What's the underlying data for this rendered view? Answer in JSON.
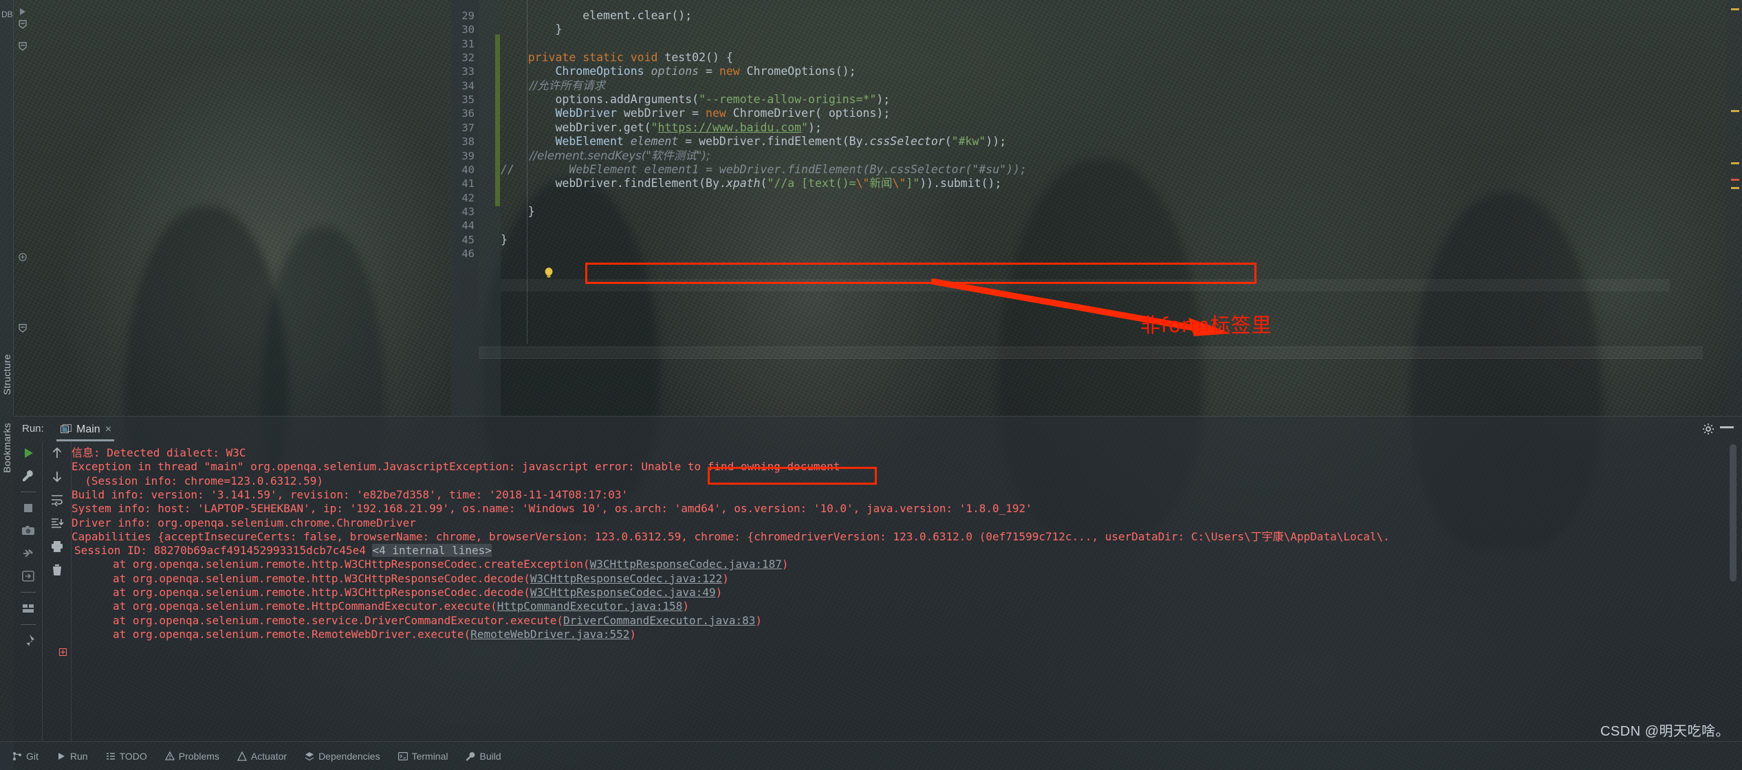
{
  "window": {
    "left_rail_top_label": "DB",
    "left_rail_structure": "Structure",
    "left_rail_bookmarks": "Bookmarks"
  },
  "editor": {
    "line_numbers": [
      "29",
      "30",
      "31",
      "32",
      "33",
      "34",
      "35",
      "36",
      "37",
      "38",
      "39",
      "40",
      "41",
      "42",
      "43",
      "44",
      "45",
      "46"
    ],
    "lines": [
      {
        "num": "29",
        "segments": [
          {
            "t": "            element",
            "c": "plain"
          },
          {
            "t": ".clear",
            "c": "plain"
          },
          {
            "t": "();",
            "c": "plain"
          }
        ]
      },
      {
        "num": "30",
        "segments": [
          {
            "t": "        }",
            "c": "plain"
          }
        ]
      },
      {
        "num": "31",
        "segments": [
          {
            "t": "",
            "c": "plain"
          }
        ]
      },
      {
        "num": "32",
        "segments": [
          {
            "t": "    private static void ",
            "c": "kw"
          },
          {
            "t": "test02",
            "c": "plain"
          },
          {
            "t": "() {",
            "c": "plain"
          }
        ]
      },
      {
        "num": "33",
        "segments": [
          {
            "t": "        ChromeOptions ",
            "c": "type"
          },
          {
            "t": "options",
            "c": "var"
          },
          {
            "t": " = ",
            "c": "plain"
          },
          {
            "t": "new ",
            "c": "kw"
          },
          {
            "t": "ChromeOptions();",
            "c": "plain"
          }
        ]
      },
      {
        "num": "34",
        "segments": [
          {
            "t": "        //允许所有请求",
            "c": "cmt"
          }
        ]
      },
      {
        "num": "35",
        "segments": [
          {
            "t": "        options.addArguments(",
            "c": "plain"
          },
          {
            "t": "\"--remote-allow-origins=*\"",
            "c": "str"
          },
          {
            "t": ");",
            "c": "plain"
          }
        ]
      },
      {
        "num": "36",
        "segments": [
          {
            "t": "        WebDriver ",
            "c": "type"
          },
          {
            "t": "webDriver",
            "c": "plain"
          },
          {
            "t": " = ",
            "c": "plain"
          },
          {
            "t": "new ",
            "c": "kw"
          },
          {
            "t": "ChromeDriver( options);",
            "c": "plain"
          }
        ]
      },
      {
        "num": "37",
        "segments": [
          {
            "t": "        webDriver.get(",
            "c": "plain"
          },
          {
            "t": "\"",
            "c": "str"
          },
          {
            "t": "https://www.baidu.com",
            "c": "link"
          },
          {
            "t": "\"",
            "c": "str"
          },
          {
            "t": ");",
            "c": "plain"
          }
        ]
      },
      {
        "num": "38",
        "segments": [
          {
            "t": "        WebElement ",
            "c": "type"
          },
          {
            "t": "element",
            "c": "var"
          },
          {
            "t": " = webDriver.findElement(By.",
            "c": "plain"
          },
          {
            "t": "cssSelector",
            "c": "meth"
          },
          {
            "t": "(",
            "c": "plain"
          },
          {
            "t": "\"#kw\"",
            "c": "str"
          },
          {
            "t": "));",
            "c": "plain"
          }
        ]
      },
      {
        "num": "39",
        "segments": [
          {
            "t": "        //element.sendKeys(\"软件测试\");",
            "c": "cmt"
          }
        ]
      },
      {
        "num": "40",
        "segments": [
          {
            "t": "//        WebElement element1 = webDriver.findElement(By.cssSelector(\"#su\"));",
            "c": "cmt"
          }
        ]
      },
      {
        "num": "41",
        "segments": [
          {
            "t": "        webDriver.findElement(By.",
            "c": "plain"
          },
          {
            "t": "xpath",
            "c": "meth"
          },
          {
            "t": "(",
            "c": "plain"
          },
          {
            "t": "\"//a [text()=",
            "c": "str"
          },
          {
            "t": "\\\"",
            "c": "esc"
          },
          {
            "t": "新闻",
            "c": "str"
          },
          {
            "t": "\\\"",
            "c": "esc"
          },
          {
            "t": "]\"",
            "c": "str"
          },
          {
            "t": ")).submit();",
            "c": "plain"
          }
        ]
      },
      {
        "num": "42",
        "segments": [
          {
            "t": "",
            "c": "plain"
          }
        ]
      },
      {
        "num": "43",
        "segments": [
          {
            "t": "    }",
            "c": "plain"
          }
        ]
      },
      {
        "num": "44",
        "segments": [
          {
            "t": "",
            "c": "plain"
          }
        ]
      },
      {
        "num": "45",
        "segments": [
          {
            "t": "}",
            "c": "plain"
          }
        ]
      },
      {
        "num": "46",
        "segments": [
          {
            "t": "",
            "c": "plain"
          }
        ]
      }
    ],
    "annotation_text": "非form标签里"
  },
  "run_panel": {
    "run_label": "Run:",
    "tab_title": "Main",
    "tab_close": "×",
    "console_lines": [
      {
        "text": "信息: Detected dialect: W3C",
        "type": "error"
      },
      {
        "text": "Exception in thread \"main\" org.openqa.selenium.JavascriptException: javascript error: Unable to find owning document",
        "type": "error"
      },
      {
        "text": "  (Session info: chrome=123.0.6312.59)",
        "type": "error"
      },
      {
        "text": "Build info: version: '3.141.59', revision: 'e82be7d358', time: '2018-11-14T08:17:03'",
        "type": "error"
      },
      {
        "text": "System info: host: 'LAPTOP-5EHEKBAN', ip: '192.168.21.99', os.name: 'Windows 10', os.arch: 'amd64', os.version: '10.0', java.version: '1.8.0_192'",
        "type": "error"
      },
      {
        "text": "Driver info: org.openqa.selenium.chrome.ChromeDriver",
        "type": "error"
      },
      {
        "text": "Capabilities {acceptInsecureCerts: false, browserName: chrome, browserVersion: 123.0.6312.59, chrome: {chromedriverVersion: 123.0.6312.0 (0ef71599c712c..., userDataDir: C:\\Users\\丁宇康\\AppData\\Local\\.",
        "type": "error"
      }
    ],
    "session_line_prefix": "Session ID: 88270b69acf491452993315dcb7c45e4",
    "session_fold": "<4 internal lines>",
    "stack_frames": [
      {
        "prefix": "at org.openqa.selenium.remote.http.W3CHttpResponseCodec.createException(",
        "link": "W3CHttpResponseCodec.java:187",
        "suffix": ")"
      },
      {
        "prefix": "at org.openqa.selenium.remote.http.W3CHttpResponseCodec.decode(",
        "link": "W3CHttpResponseCodec.java:122",
        "suffix": ")"
      },
      {
        "prefix": "at org.openqa.selenium.remote.http.W3CHttpResponseCodec.decode(",
        "link": "W3CHttpResponseCodec.java:49",
        "suffix": ")"
      },
      {
        "prefix": "at org.openqa.selenium.remote.HttpCommandExecutor.execute(",
        "link": "HttpCommandExecutor.java:158",
        "suffix": ")"
      },
      {
        "prefix": "at org.openqa.selenium.remote.service.DriverCommandExecutor.execute(",
        "link": "DriverCommandExecutor.java:83",
        "suffix": ")"
      },
      {
        "prefix": "at org.openqa.selenium.remote.RemoteWebDriver.execute(",
        "link": "RemoteWebDriver.java:552",
        "suffix": ")"
      }
    ],
    "highlighted_error": "Unable to find owning document"
  },
  "status_bar": {
    "items": [
      {
        "label": "Git",
        "icon": "git-icon"
      },
      {
        "label": "Run",
        "icon": "run-icon"
      },
      {
        "label": "TODO",
        "icon": "todo-icon"
      },
      {
        "label": "Problems",
        "icon": "problems-icon"
      },
      {
        "label": "Actuator",
        "icon": "actuator-icon"
      },
      {
        "label": "Dependencies",
        "icon": "dependencies-icon"
      },
      {
        "label": "Terminal",
        "icon": "terminal-icon"
      },
      {
        "label": "Build",
        "icon": "build-icon"
      }
    ]
  },
  "watermark": "CSDN @明天吃啥。",
  "colors": {
    "accent_red": "#ff2a00",
    "console_red": "#ff6b68",
    "keyword_orange": "#cc7832",
    "string_green": "#7fa86a",
    "run_green": "#4fae42"
  }
}
